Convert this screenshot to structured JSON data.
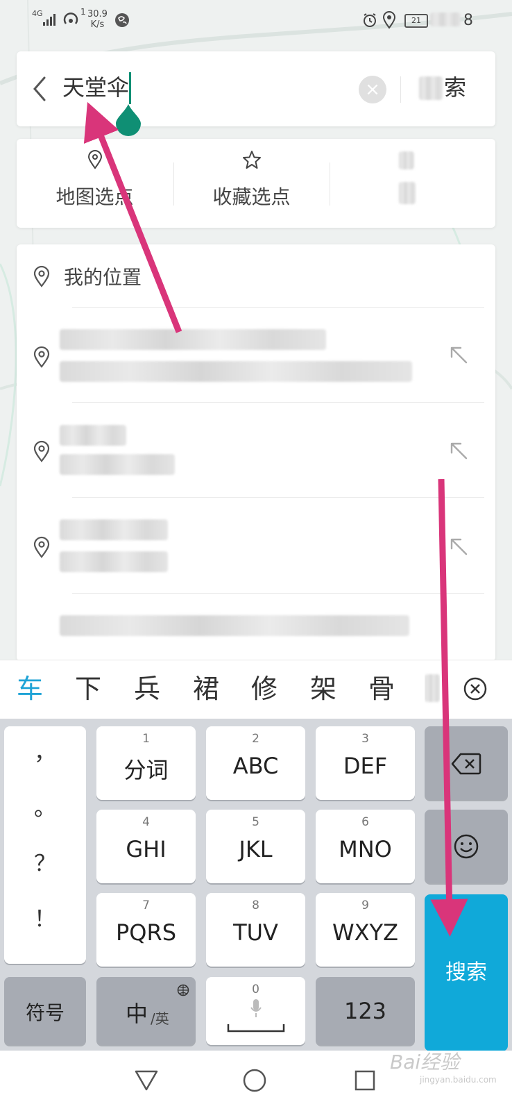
{
  "status_bar": {
    "network_type": "4G",
    "network_speed": "30.9",
    "network_speed_unit": "K/s",
    "hotspot_count": "1",
    "battery_level": "21",
    "clock_suffix": "8"
  },
  "search": {
    "query": "天堂伞",
    "search_label": "索"
  },
  "quick_actions": {
    "items": [
      {
        "label": "地图选点",
        "icon": "location-pin-icon"
      },
      {
        "label": "收藏选点",
        "icon": "star-icon"
      }
    ]
  },
  "results": {
    "my_location_label": "我的位置"
  },
  "ime": {
    "candidates": [
      "车",
      "下",
      "兵",
      "裙",
      "修",
      "架",
      "骨"
    ],
    "punctuation": [
      "，",
      "。",
      "？",
      "！"
    ],
    "keys": [
      {
        "num": "1",
        "label": "分词"
      },
      {
        "num": "2",
        "label": "ABC"
      },
      {
        "num": "3",
        "label": "DEF"
      },
      {
        "num": "4",
        "label": "GHI"
      },
      {
        "num": "5",
        "label": "JKL"
      },
      {
        "num": "6",
        "label": "MNO"
      },
      {
        "num": "7",
        "label": "PQRS"
      },
      {
        "num": "8",
        "label": "TUV"
      },
      {
        "num": "9",
        "label": "WXYZ"
      }
    ],
    "symbols_label": "符号",
    "lang_main": "中",
    "lang_sub": "/英",
    "space_num": "0",
    "num_label": "123",
    "search_label": "搜索"
  },
  "watermark": {
    "brand": "Bai经验",
    "sub": "jingyan.baidu.com"
  },
  "colors": {
    "accent_teal": "#0f8f74",
    "ime_blue": "#10a9d9",
    "annotation_pink": "#d9357a"
  }
}
